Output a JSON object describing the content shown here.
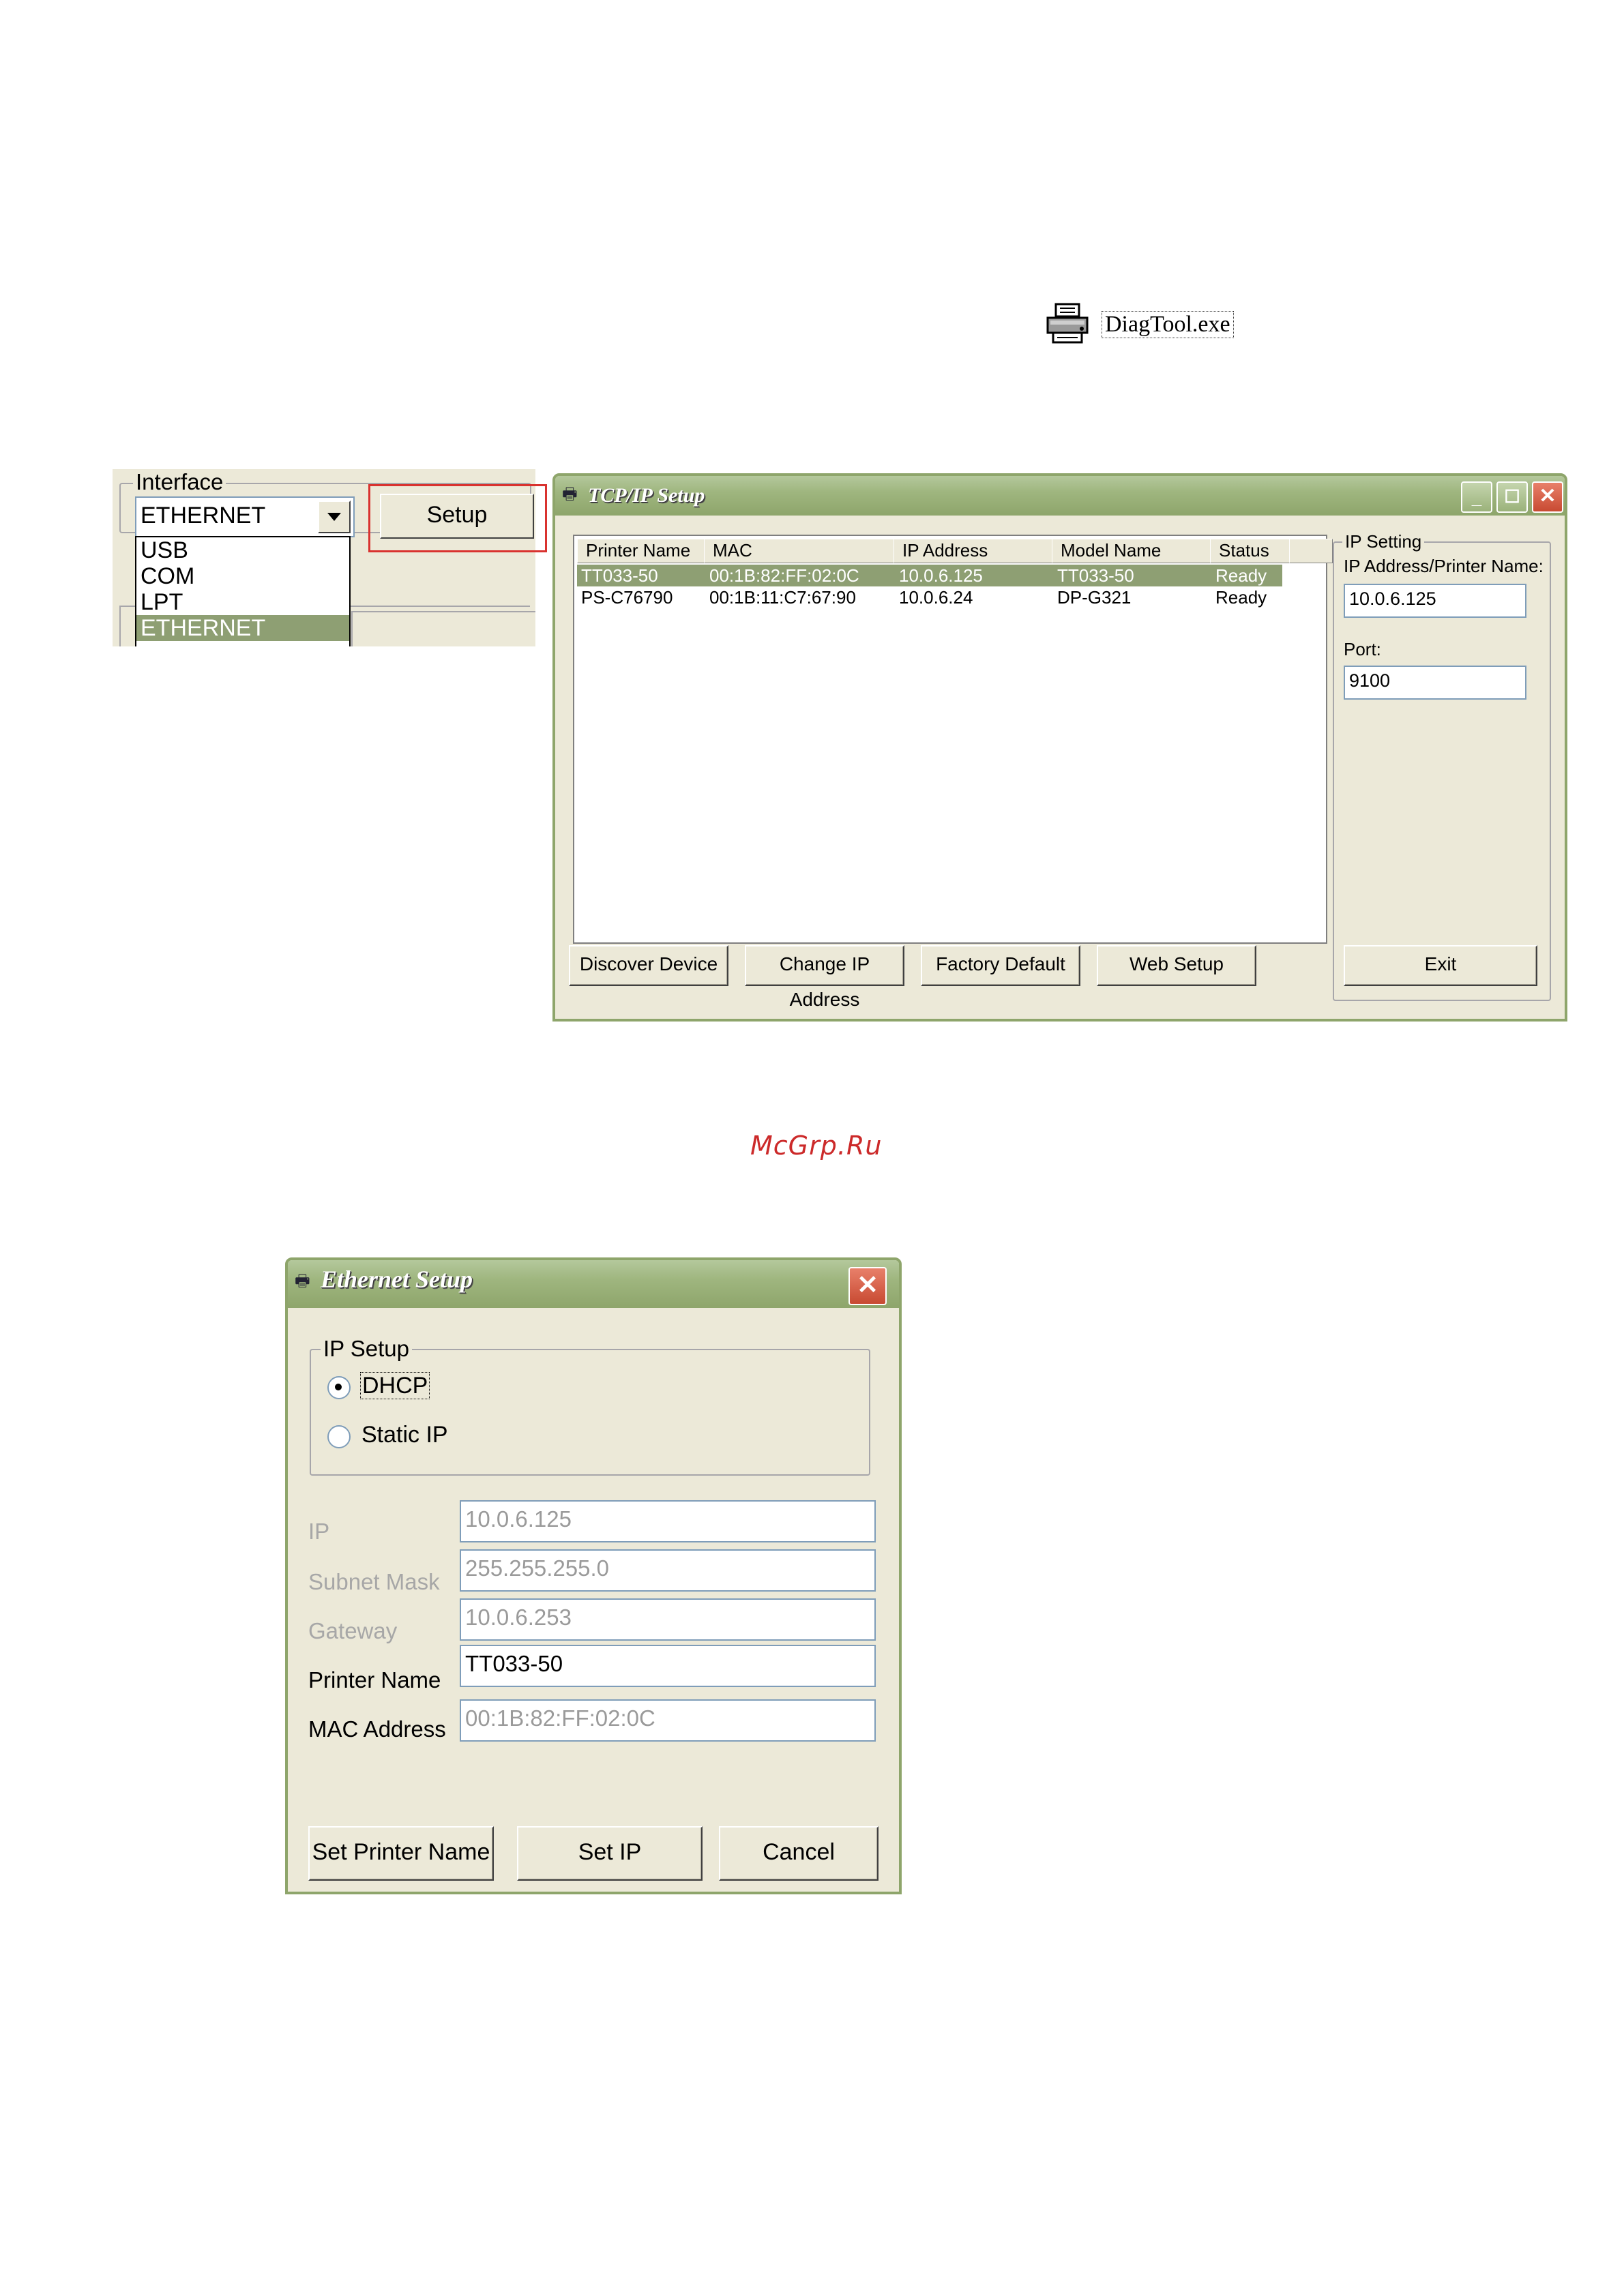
{
  "diagtool": {
    "icon": "printer-icon",
    "label": "DiagTool.exe"
  },
  "interface": {
    "group_title": "Interface",
    "selected": "ETHERNET",
    "setup_button": "Setup",
    "options": [
      "USB",
      "COM",
      "LPT",
      "ETHERNET"
    ]
  },
  "tcpip": {
    "title": "TCP/IP Setup",
    "columns": [
      "Printer Name",
      "MAC",
      "IP Address",
      "Model Name",
      "Status"
    ],
    "rows": [
      {
        "name": "TT033-50",
        "mac": "00:1B:82:FF:02:0C",
        "ip": "10.0.6.125",
        "model": "TT033-50",
        "status": "Ready",
        "selected": true
      },
      {
        "name": "PS-C76790",
        "mac": "00:1B:11:C7:67:90",
        "ip": "10.0.6.24",
        "model": "DP-G321",
        "status": "Ready",
        "selected": false
      }
    ],
    "buttons": {
      "discover": "Discover Device",
      "change_ip": "Change IP Address",
      "factory": "Factory Default",
      "web": "Web Setup",
      "exit": "Exit"
    },
    "ip_setting": {
      "group_title": "IP Setting",
      "address_label": "IP Address/Printer Name:",
      "address_value": "10.0.6.125",
      "port_label": "Port:",
      "port_value": "9100"
    }
  },
  "watermark": "McGrp.Ru",
  "ethernet": {
    "title": "Ethernet Setup",
    "ip_setup": {
      "group_title": "IP Setup",
      "dhcp": "DHCP",
      "static": "Static IP",
      "selected": "DHCP"
    },
    "fields": {
      "ip": {
        "label": "IP",
        "value": "10.0.6.125",
        "enabled": false
      },
      "subnet": {
        "label": "Subnet Mask",
        "value": "255.255.255.0",
        "enabled": false
      },
      "gateway": {
        "label": "Gateway",
        "value": "10.0.6.253",
        "enabled": false
      },
      "printer_name": {
        "label": "Printer Name",
        "value": "TT033-50",
        "enabled": true
      },
      "mac": {
        "label": "MAC Address",
        "value": "00:1B:82:FF:02:0C",
        "enabled": false
      }
    },
    "buttons": {
      "set_name": "Set Printer Name",
      "set_ip": "Set IP",
      "cancel": "Cancel"
    }
  }
}
